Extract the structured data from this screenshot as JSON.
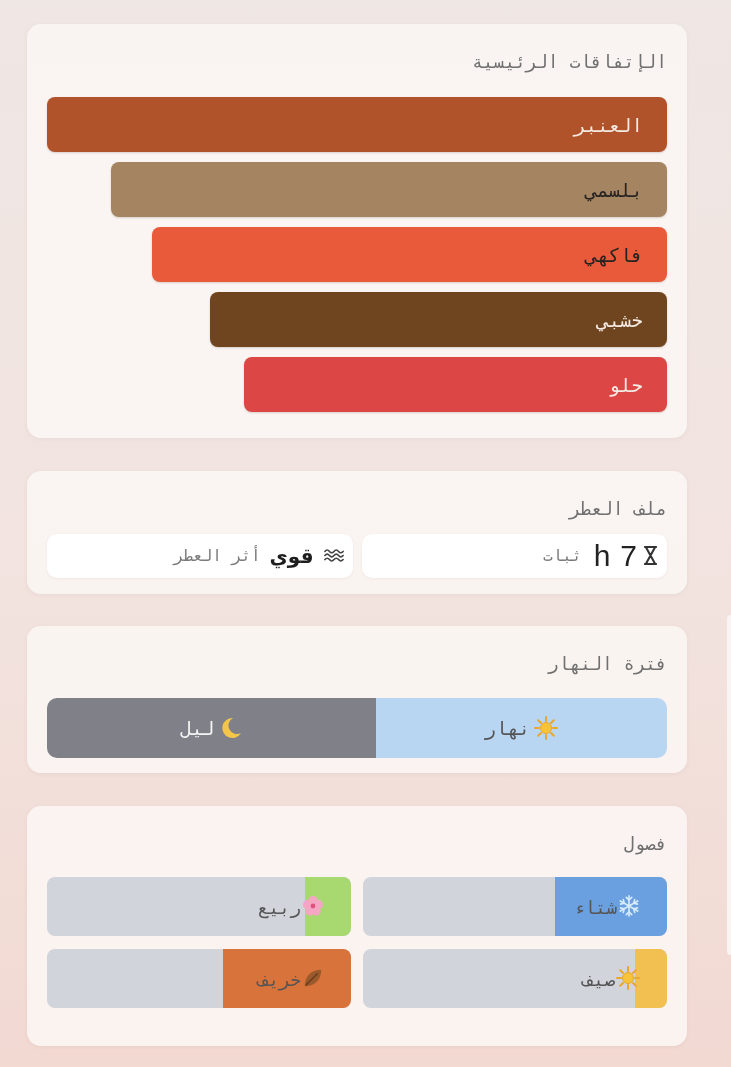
{
  "accords": {
    "title": "الإتفاقات الرئيسية",
    "items": [
      {
        "name": "العنبر",
        "color": "#b0522a",
        "level": 1
      },
      {
        "name": "بلسمي",
        "color": "#a58561",
        "level": 0.897
      },
      {
        "name": "فاكهي",
        "color": "#e85a3a",
        "level": 0.831
      },
      {
        "name": "خشبي",
        "color": "#6f451f",
        "level": 0.737
      },
      {
        "name": "حلو",
        "color": "#dc4645",
        "level": 0.682
      }
    ]
  },
  "profile": {
    "title": "ملف العطر",
    "stats": [
      {
        "kind": "longevity",
        "value": "7",
        "unit": "h",
        "label": "ثبات"
      },
      {
        "kind": "sillage",
        "value": "قوي",
        "label": "أثر العطر"
      }
    ]
  },
  "time_of_day": {
    "title": "فترة النهار",
    "segments": [
      {
        "kind": "day",
        "label": "نهار",
        "level": 0.47,
        "color": "#b8d5f2"
      },
      {
        "kind": "night",
        "label": "ليل",
        "level": 0.53,
        "color": "#808088"
      }
    ]
  },
  "seasons": {
    "title": "فصول",
    "items": [
      {
        "kind": "winter",
        "label": "شتاء",
        "level": 0.37,
        "color": "#6aa0e0"
      },
      {
        "kind": "spring",
        "label": "ربيع",
        "level": 0.15,
        "color": "#a8d870"
      },
      {
        "kind": "summer",
        "label": "صيف",
        "level": 0.105,
        "color": "#f2c050"
      },
      {
        "kind": "autumn",
        "label": "خريف",
        "level": 0.42,
        "color": "#d8733c"
      }
    ]
  }
}
